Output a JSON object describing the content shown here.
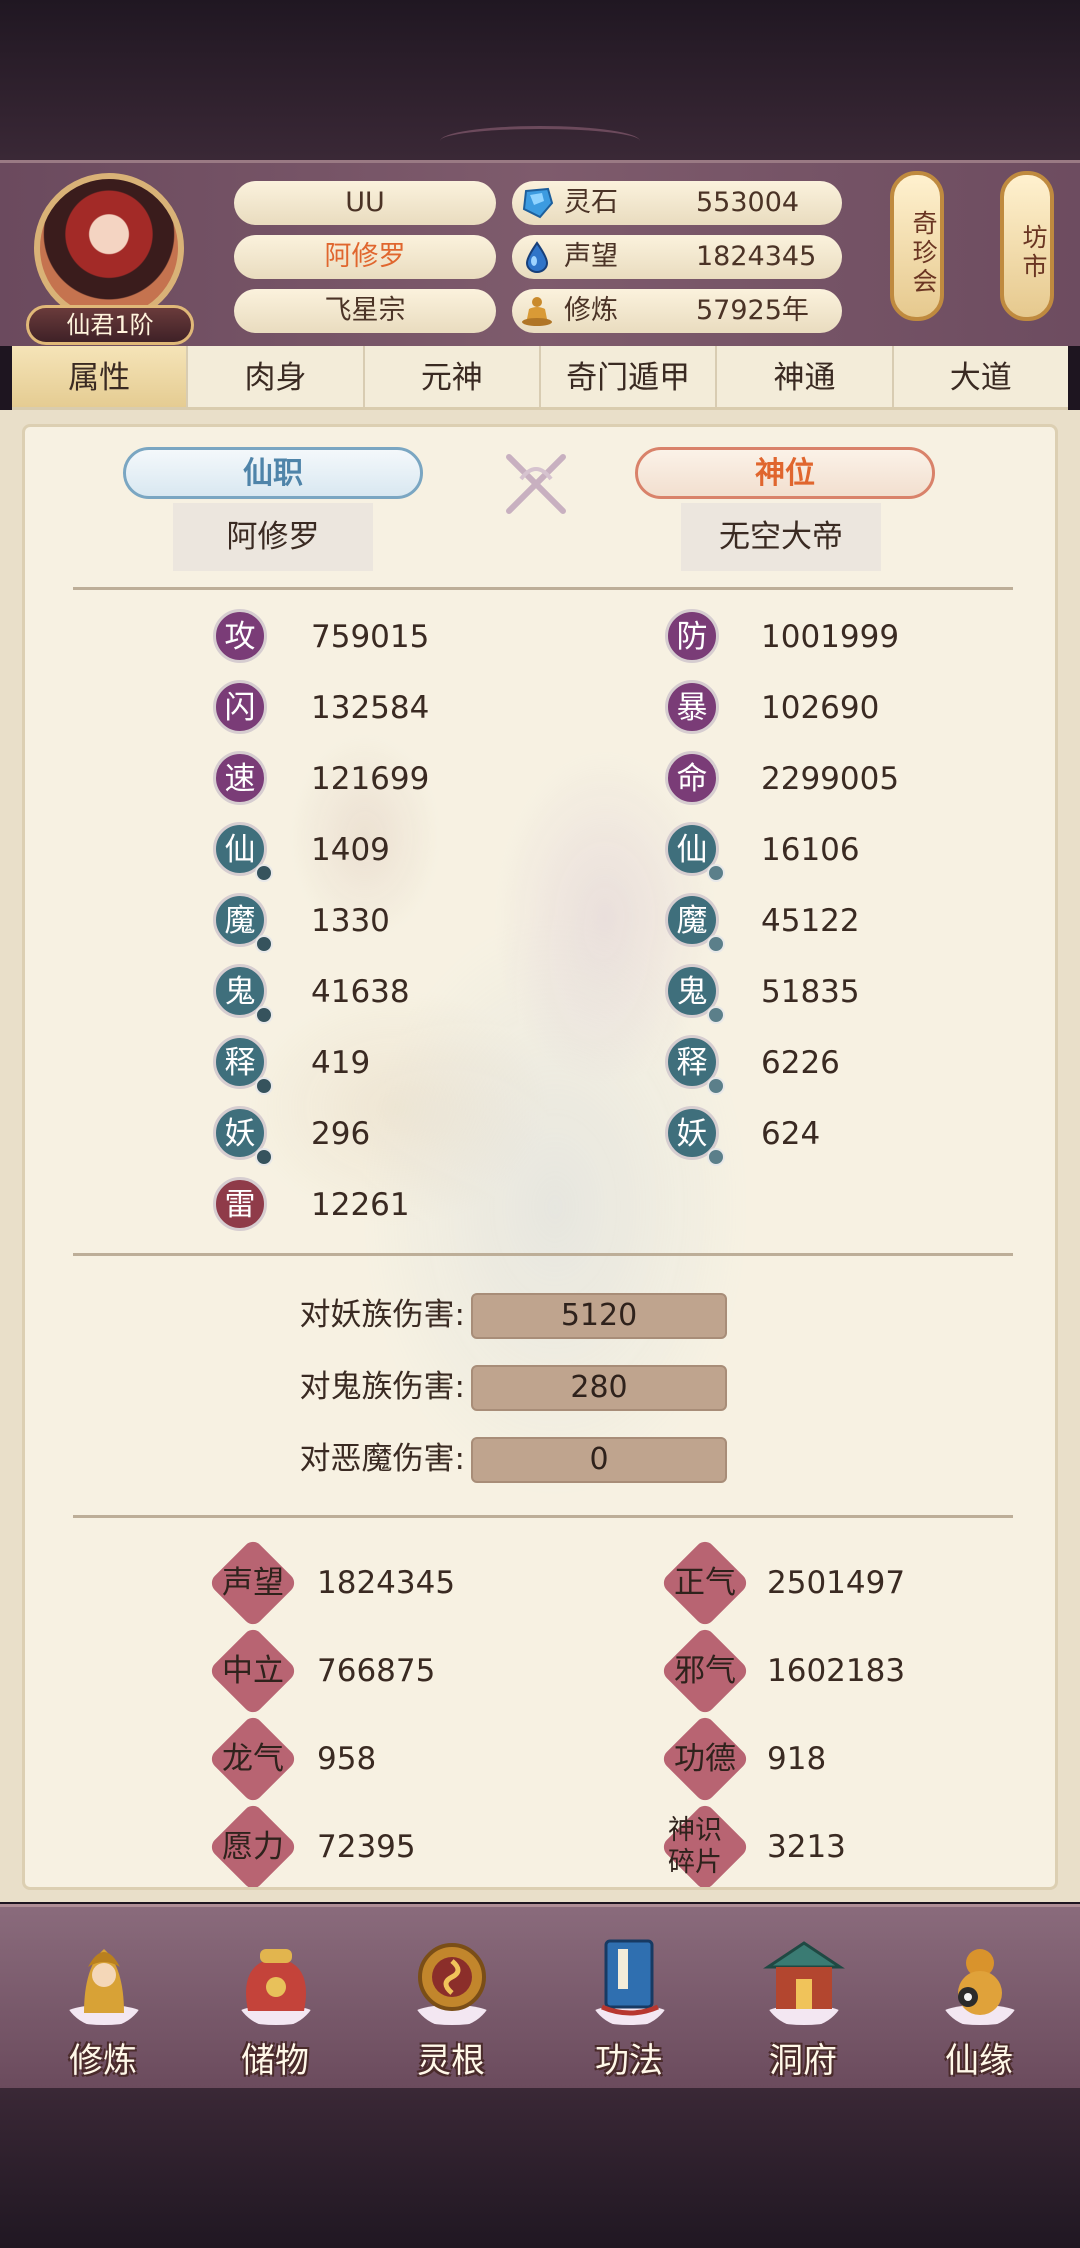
{
  "header": {
    "rank": "仙君1阶",
    "player_name": "UU",
    "title": "阿修罗",
    "sect": "飞星宗",
    "resources": [
      {
        "icon": "spirit-stone-icon",
        "label": "灵石",
        "value": "553004"
      },
      {
        "icon": "reputation-drop-icon",
        "label": "声望",
        "value": "1824345"
      },
      {
        "icon": "meditation-icon",
        "label": "修炼",
        "value": "57925年"
      }
    ],
    "side_buttons": [
      "奇珍会",
      "坊市"
    ]
  },
  "tabs": [
    "属性",
    "肉身",
    "元神",
    "奇门遁甲",
    "神通",
    "大道"
  ],
  "active_tab": "属性",
  "titles": {
    "left_banner": "仙职",
    "left_value": "阿修罗",
    "right_banner": "神位",
    "right_value": "无空大帝"
  },
  "stats_left": [
    {
      "label": "攻",
      "value": "759015",
      "color": "purple"
    },
    {
      "label": "闪",
      "value": "132584",
      "color": "purple"
    },
    {
      "label": "速",
      "value": "121699",
      "color": "purple"
    },
    {
      "label": "仙",
      "value": "1409",
      "color": "teal"
    },
    {
      "label": "魔",
      "value": "1330",
      "color": "teal"
    },
    {
      "label": "鬼",
      "value": "41638",
      "color": "teal"
    },
    {
      "label": "释",
      "value": "419",
      "color": "teal"
    },
    {
      "label": "妖",
      "value": "296",
      "color": "teal"
    },
    {
      "label": "雷",
      "value": "12261",
      "color": "red"
    }
  ],
  "stats_right": [
    {
      "label": "防",
      "value": "1001999",
      "color": "purple"
    },
    {
      "label": "暴",
      "value": "102690",
      "color": "purple"
    },
    {
      "label": "命",
      "value": "2299005",
      "color": "purple"
    },
    {
      "label": "仙",
      "value": "16106",
      "color": "teal"
    },
    {
      "label": "魔",
      "value": "45122",
      "color": "teal"
    },
    {
      "label": "鬼",
      "value": "51835",
      "color": "teal"
    },
    {
      "label": "释",
      "value": "6226",
      "color": "teal"
    },
    {
      "label": "妖",
      "value": "624",
      "color": "teal"
    }
  ],
  "damage": [
    {
      "label": "对妖族伤害:",
      "value": "5120"
    },
    {
      "label": "对鬼族伤害:",
      "value": "280"
    },
    {
      "label": "对恶魔伤害:",
      "value": "0"
    }
  ],
  "reputation_left": [
    {
      "label": "声望",
      "value": "1824345"
    },
    {
      "label": "中立",
      "value": "766875"
    },
    {
      "label": "龙气",
      "value": "958"
    },
    {
      "label": "愿力",
      "value": "72395"
    }
  ],
  "reputation_right": [
    {
      "label": "正气",
      "value": "2501497"
    },
    {
      "label": "邪气",
      "value": "1602183"
    },
    {
      "label": "功德",
      "value": "918"
    },
    {
      "label": "神识碎片",
      "value": "3213"
    }
  ],
  "bottom_nav": [
    {
      "label": "修炼",
      "icon": "cultivate-icon"
    },
    {
      "label": "储物",
      "icon": "storage-bag-icon"
    },
    {
      "label": "灵根",
      "icon": "spirit-root-icon"
    },
    {
      "label": "功法",
      "icon": "technique-book-icon"
    },
    {
      "label": "洞府",
      "icon": "cave-mansion-icon"
    },
    {
      "label": "仙缘",
      "icon": "fate-gourd-icon"
    }
  ],
  "colors": {
    "stat_purple": "#7a3c77",
    "stat_teal": "#3f6f7c",
    "stat_red": "#8f3b49",
    "title_orange": "#e0662e",
    "title_blue": "#4f84a9"
  }
}
